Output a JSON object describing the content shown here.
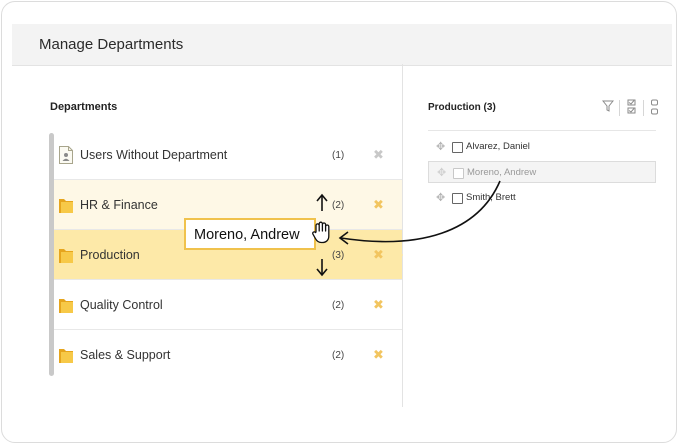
{
  "window": {
    "title": "Manage Departments"
  },
  "departments": {
    "heading": "Departments",
    "items": [
      {
        "name": "Users Without Department",
        "count": "(1)",
        "icon": "user-card-icon",
        "state": "normal"
      },
      {
        "name": "HR & Finance",
        "count": "(2)",
        "icon": "folder-icon",
        "state": "light"
      },
      {
        "name": "Production",
        "count": "(3)",
        "icon": "folder-icon",
        "state": "active"
      },
      {
        "name": "Quality Control",
        "count": "(2)",
        "icon": "folder-icon",
        "state": "normal"
      },
      {
        "name": "Sales & Support",
        "count": "(2)",
        "icon": "folder-icon",
        "state": "normal"
      }
    ],
    "delete_icon": "close-icon"
  },
  "members": {
    "heading": "Production (3)",
    "tools": [
      "filter-icon",
      "check-list-icon",
      "links-icon"
    ],
    "items": [
      {
        "name": "Alvarez, Daniel",
        "state": "normal"
      },
      {
        "name": "Moreno, Andrew",
        "state": "dragging"
      },
      {
        "name": "Smith, Brett",
        "state": "normal"
      }
    ]
  },
  "drag": {
    "label": "Moreno, Andrew"
  },
  "colors": {
    "active_row": "#fde9a8",
    "light_row": "#fef8e6",
    "drag_border": "#f0c24c",
    "delete_gold": "#f2c560",
    "delete_grey": "#c8c8c8"
  }
}
